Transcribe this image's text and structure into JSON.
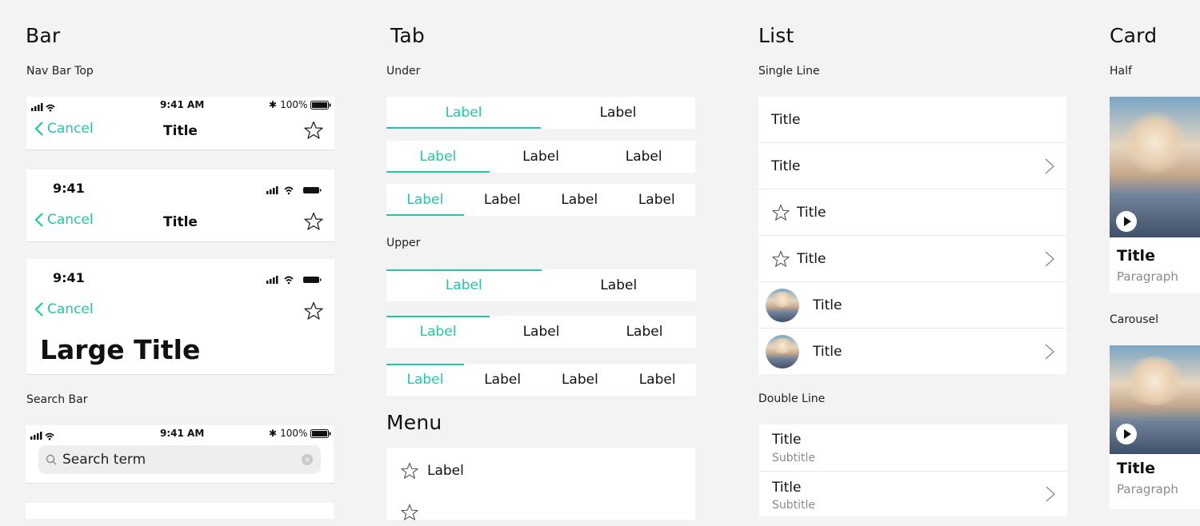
{
  "bar": {
    "heading": "Bar",
    "nav_bar_top_label": "Nav Bar Top",
    "status_signal_time": "9:41 AM",
    "status_battery_pct": "100%",
    "status_short_time": "9:41",
    "cancel_label": "Cancel",
    "nav_title": "Title",
    "large_title": "Large Title",
    "search_bar_label": "Search Bar",
    "search_placeholder": "Search term"
  },
  "tab": {
    "heading": "Tab",
    "under_label": "Under",
    "upper_label": "Upper",
    "tab_label": "Label",
    "menu_heading": "Menu",
    "menu_item_label": "Label"
  },
  "list": {
    "heading": "List",
    "single_line_label": "Single Line",
    "row_title": "Title",
    "double_line_label": "Double Line",
    "row_subtitle": "Subtitle"
  },
  "card": {
    "heading": "Card",
    "half_label": "Half",
    "card_title": "Title",
    "card_paragraph": "Paragraph",
    "carousel_label": "Carousel"
  },
  "colors": {
    "accent": "#1fc9a6",
    "background": "#f3f3f3"
  }
}
